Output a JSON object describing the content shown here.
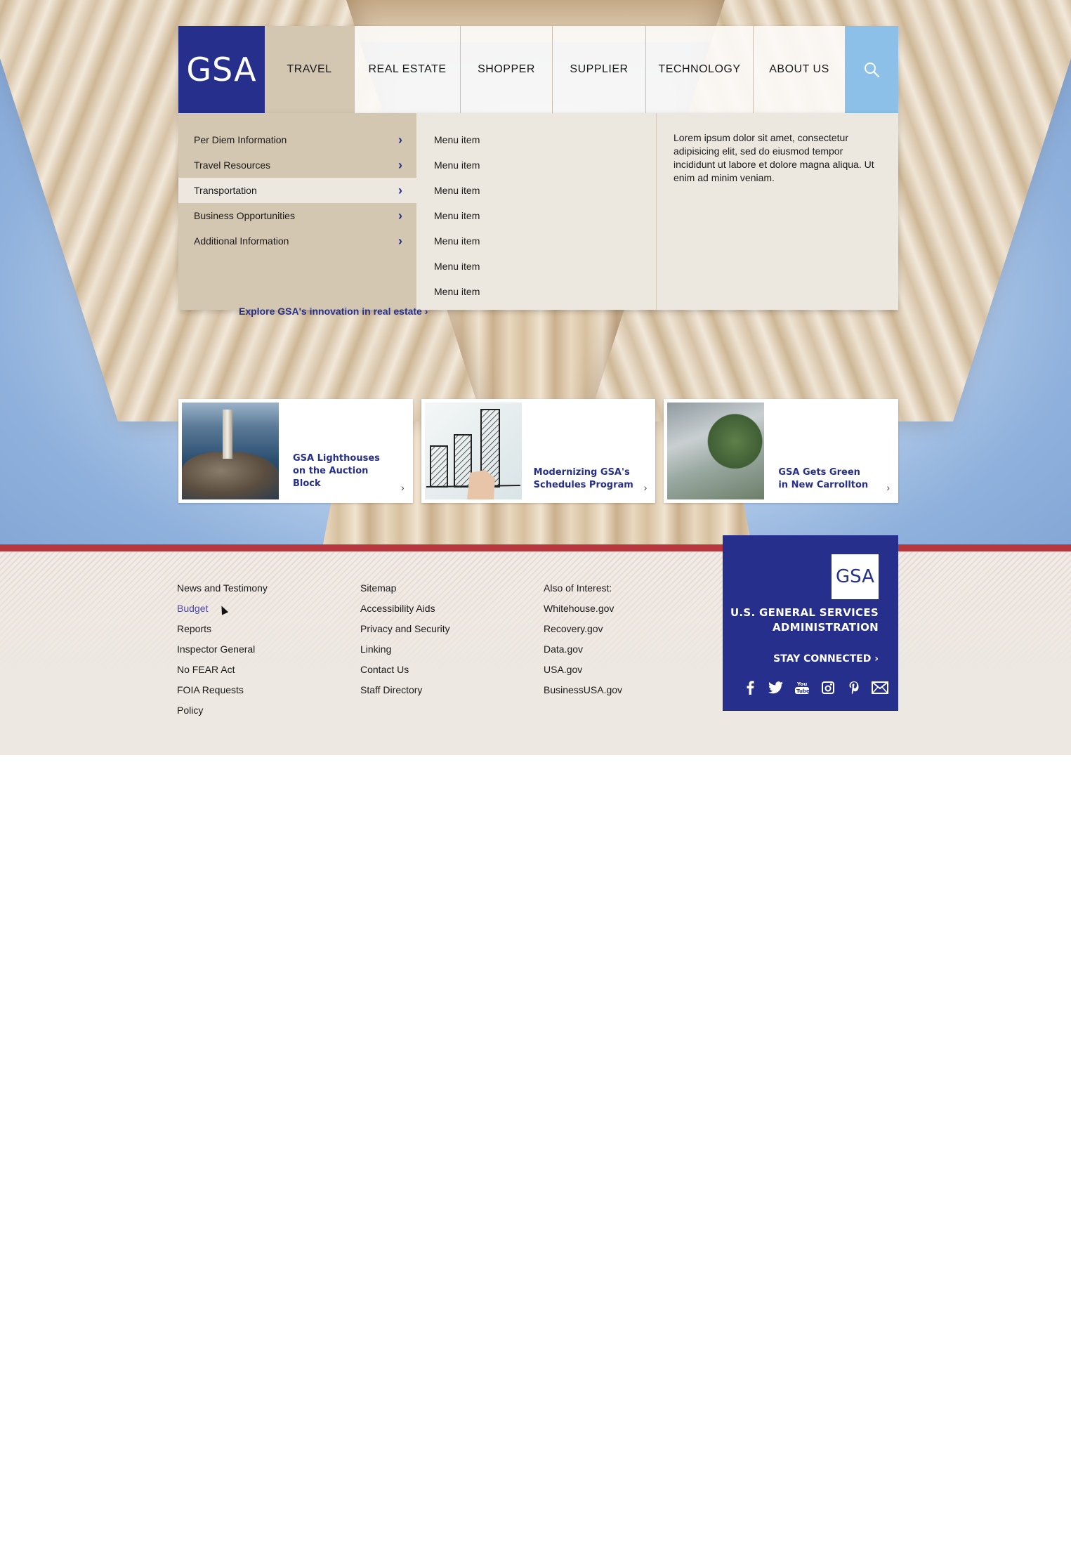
{
  "nav": {
    "logo": "GSA",
    "tabs": [
      {
        "label": "TRAVEL"
      },
      {
        "label": "REAL ESTATE"
      },
      {
        "label": "SHOPPER"
      },
      {
        "label": "SUPPLIER"
      },
      {
        "label": "TECHNOLOGY"
      },
      {
        "label": "ABOUT US"
      }
    ],
    "search_icon": "search-icon"
  },
  "mega_menu": {
    "left_items": [
      {
        "label": "Per Diem Information"
      },
      {
        "label": "Travel Resources"
      },
      {
        "label": "Transportation"
      },
      {
        "label": "Business Opportunities"
      },
      {
        "label": "Additional Information"
      }
    ],
    "mid_items": [
      {
        "label": "Menu item"
      },
      {
        "label": "Menu item"
      },
      {
        "label": "Menu item"
      },
      {
        "label": "Menu item"
      },
      {
        "label": "Menu item"
      },
      {
        "label": "Menu item"
      },
      {
        "label": "Menu item"
      }
    ],
    "description": "Lorem ipsum dolor sit amet, consectetur adipisicing elit, sed do eiusmod tempor incididunt ut labore et dolore magna aliqua. Ut enim ad minim veniam."
  },
  "hero": {
    "explore_link": "Explore GSA's innovation in real estate ›"
  },
  "cards": [
    {
      "title_lines": [
        "GSA Lighthouses",
        "on the Auction",
        "Block"
      ]
    },
    {
      "title_lines": [
        "Modernizing GSA's",
        "Schedules Program"
      ]
    },
    {
      "title_lines": [
        "GSA Gets Green",
        "in New Carrollton"
      ]
    }
  ],
  "footer": {
    "col1": [
      "News and Testimony",
      "Budget",
      "Reports",
      "Inspector General",
      "No FEAR Act",
      "FOIA Requests",
      "Policy"
    ],
    "col2": [
      "Sitemap",
      "Accessibility Aids",
      "Privacy and Security",
      "Linking",
      "Contact Us",
      "Staff Directory"
    ],
    "col3": [
      "Also of Interest:",
      "Whitehouse.gov",
      "Recovery.gov",
      "Data.gov",
      "USA.gov",
      "BusinessUSA.gov"
    ]
  },
  "brand": {
    "logo": "GSA",
    "name_line1": "U.S. GENERAL SERVICES",
    "name_line2": "ADMINISTRATION",
    "stay_connected": "STAY CONNECTED ›",
    "social": [
      "facebook-icon",
      "twitter-icon",
      "youtube-icon",
      "instagram-icon",
      "pinterest-icon",
      "email-icon"
    ]
  },
  "colors": {
    "brand_blue": "#262f8b",
    "search_blue": "#8cc0e8",
    "footer_red": "#b8373e",
    "menu_tan": "#d3c7b2",
    "menu_light": "#ede8df"
  }
}
